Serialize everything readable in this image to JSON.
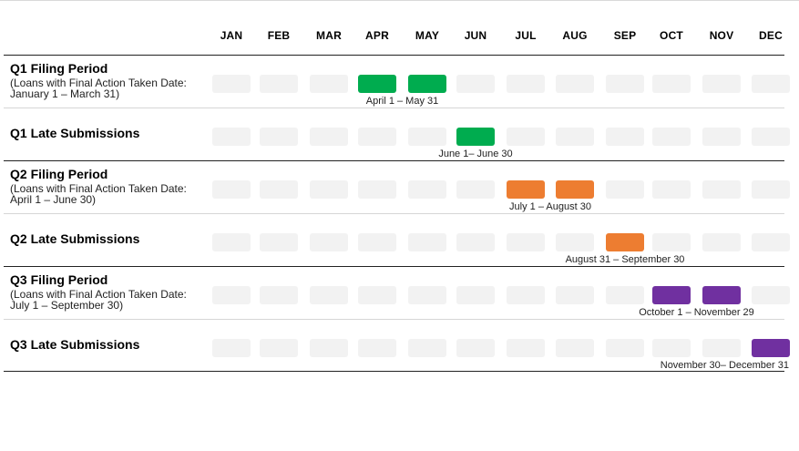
{
  "months": [
    "JAN",
    "FEB",
    "MAR",
    "APR",
    "MAY",
    "JUN",
    "JUL",
    "AUG",
    "SEP",
    "OCT",
    "NOV",
    "DEC"
  ],
  "colors": {
    "inactive": "#f2f2f2",
    "q1": "#00ac4f",
    "q2": "#ed7d31",
    "q3": "#7030a0"
  },
  "rows": [
    {
      "title": "Q1 Filing Period",
      "subtitle": "(Loans with Final Action Taken Date: January 1 – March 31)",
      "active_months": [
        "APR",
        "MAY"
      ],
      "color": "green",
      "range_label": "April 1 – May 31"
    },
    {
      "title": "Q1 Late Submissions",
      "subtitle": "",
      "active_months": [
        "JUN"
      ],
      "color": "green",
      "range_label": "June 1– June 30"
    },
    {
      "title": "Q2 Filing Period",
      "subtitle": "(Loans with Final Action Taken Date: April 1 – June 30)",
      "active_months": [
        "JUL",
        "AUG"
      ],
      "color": "orange",
      "range_label": "July 1 – August 30"
    },
    {
      "title": "Q2 Late Submissions",
      "subtitle": "",
      "active_months": [
        "SEP"
      ],
      "color": "orange",
      "range_label": "August  31 – September 30"
    },
    {
      "title": "Q3 Filing Period",
      "subtitle": "(Loans with Final Action Taken Date: July 1 – September 30)",
      "active_months": [
        "OCT",
        "NOV"
      ],
      "color": "purple",
      "range_label": "October 1 – November 29"
    },
    {
      "title": "Q3 Late Submissions",
      "subtitle": "",
      "active_months": [
        "DEC"
      ],
      "color": "purple",
      "range_label": "November 30– December 31"
    }
  ]
}
